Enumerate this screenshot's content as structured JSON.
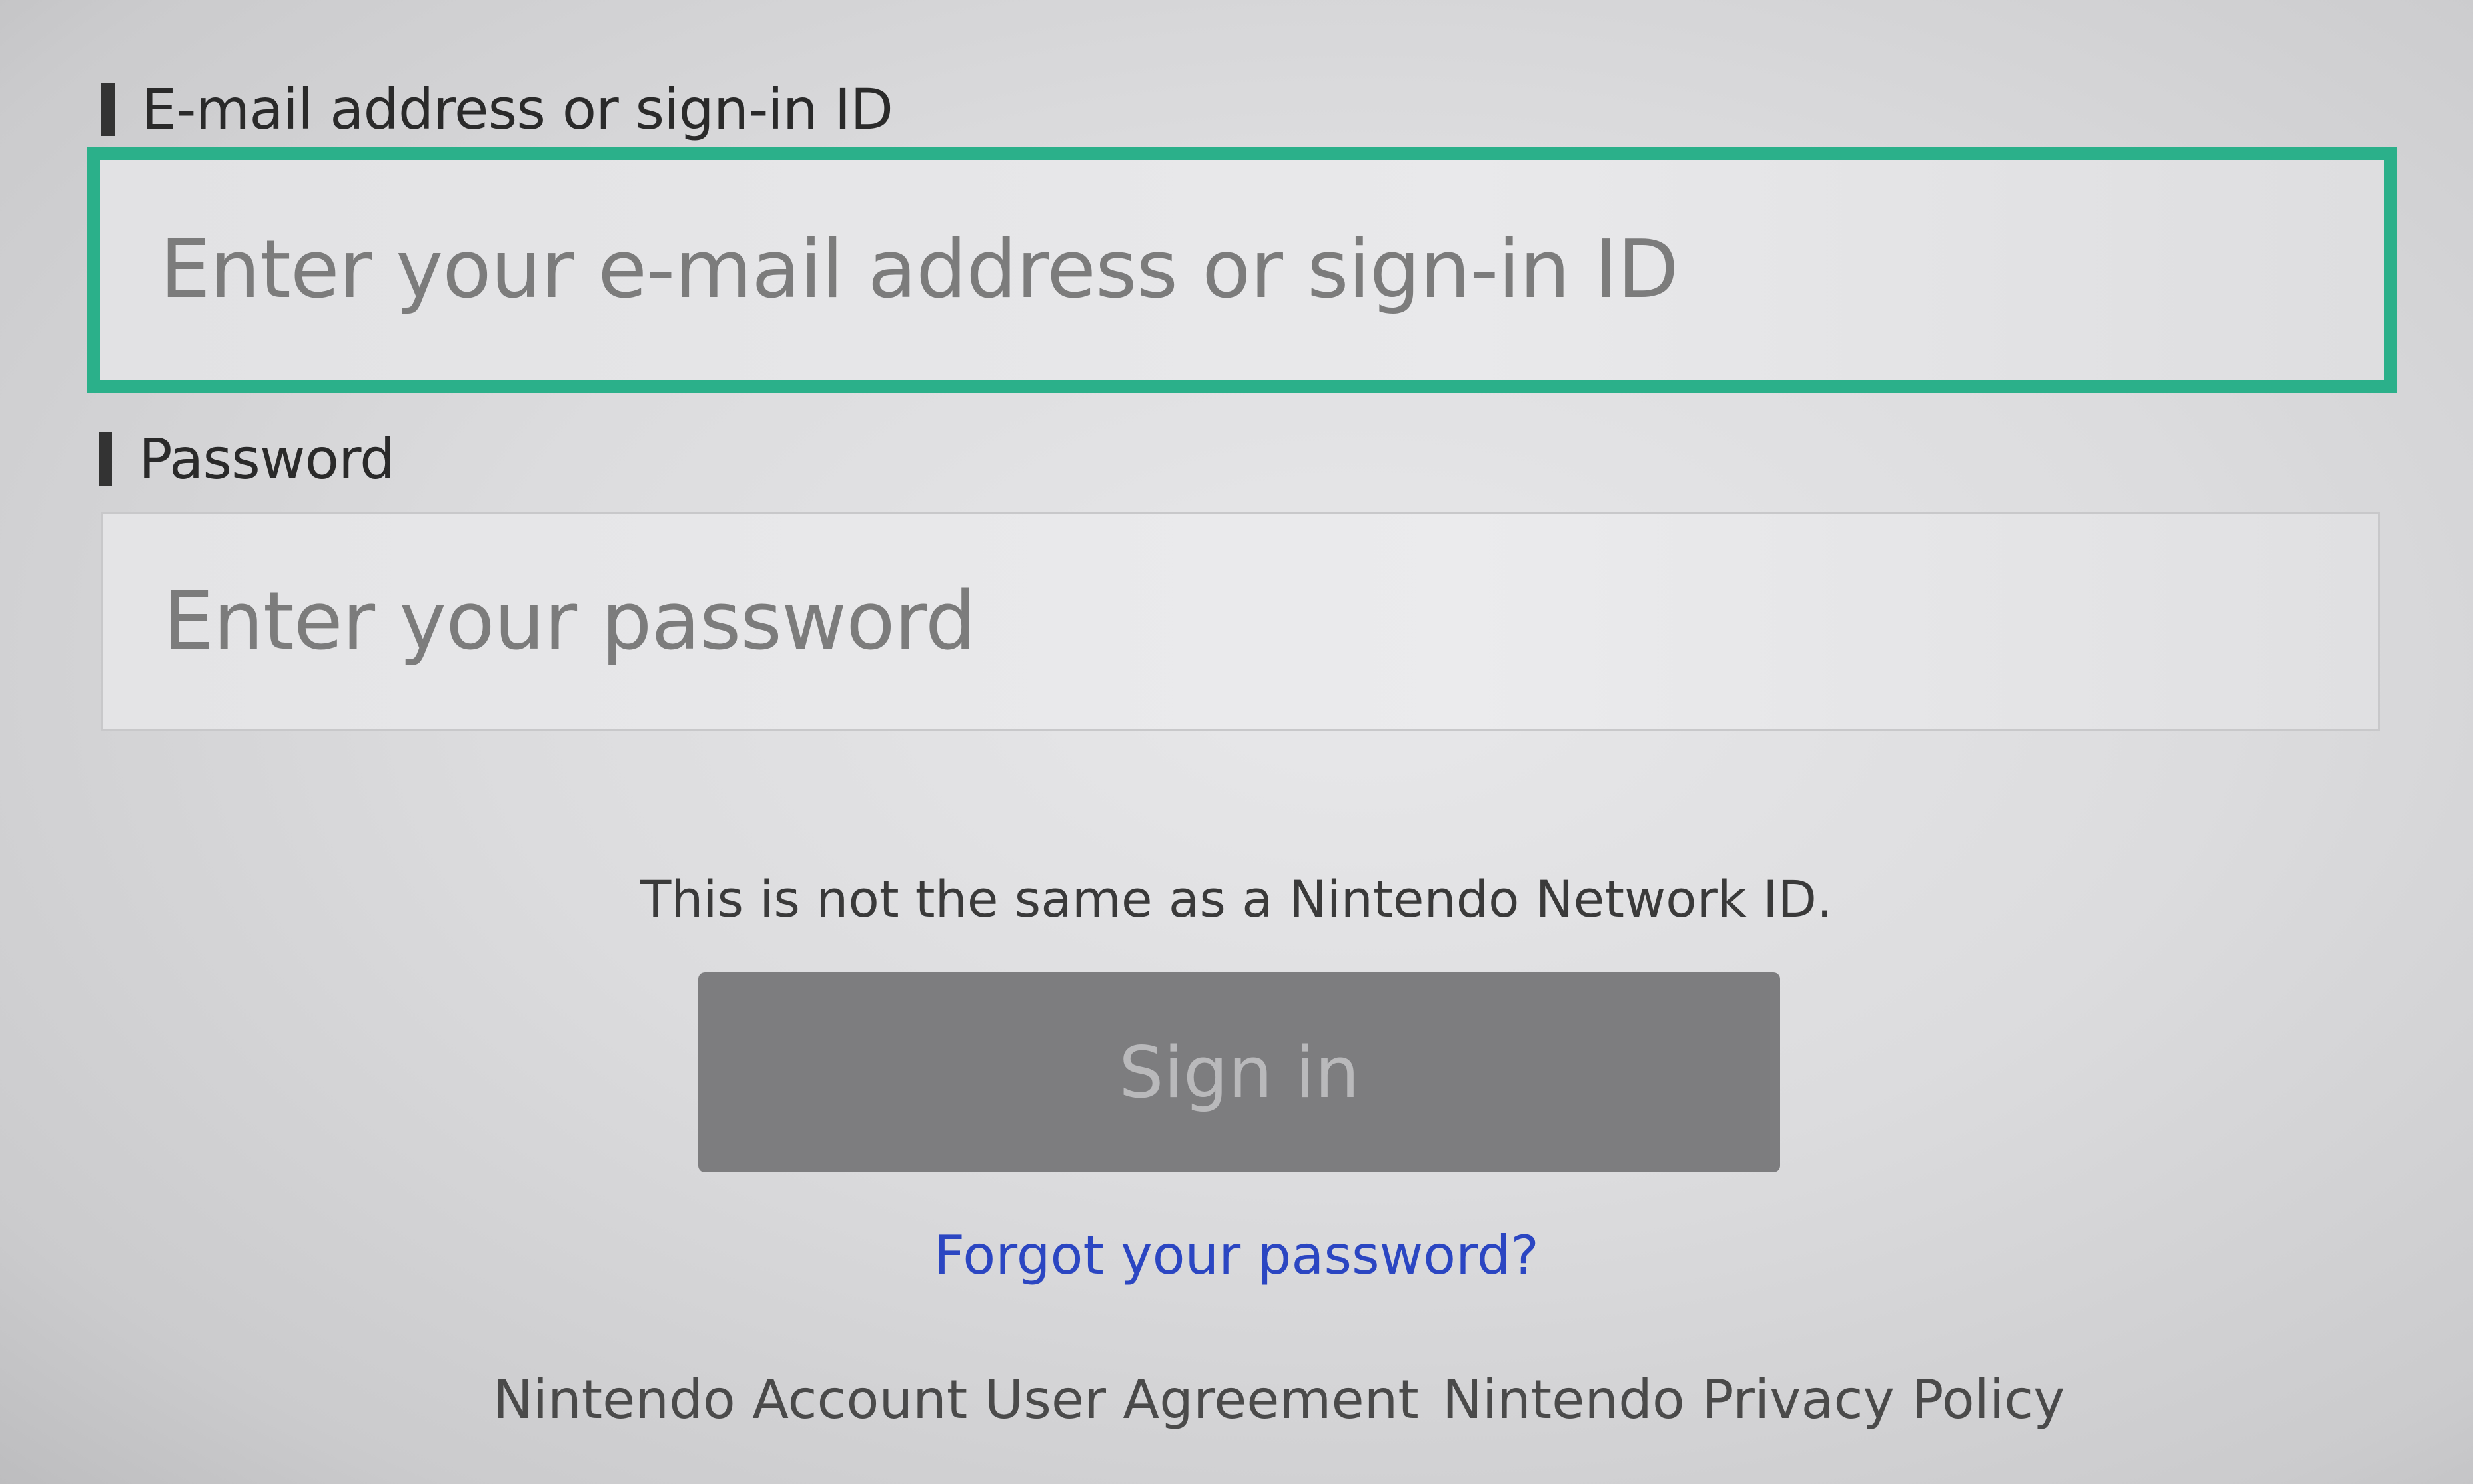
{
  "email": {
    "label": "E-mail address or sign-in ID",
    "placeholder": "Enter your e-mail address or sign-in ID",
    "value": ""
  },
  "password": {
    "label": "Password",
    "placeholder": "Enter your password",
    "value": ""
  },
  "notice": "This is not the same as a Nintendo Network ID.",
  "sign_in_label": "Sign in",
  "forgot_password_label": "Forgot your password?",
  "footer": {
    "agreement_label": "Nintendo Account User Agreement",
    "privacy_label": "Nintendo Privacy Policy"
  },
  "colors": {
    "focus_border": "#2bb08a",
    "button_bg": "#7d7d7f",
    "link": "#2b46c2"
  }
}
